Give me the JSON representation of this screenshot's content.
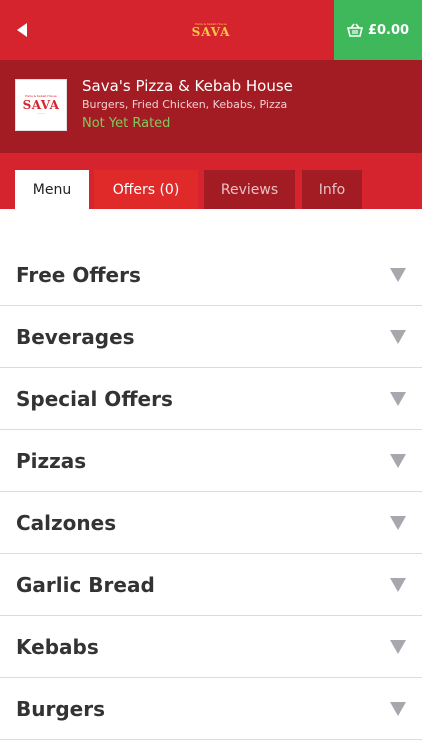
{
  "header": {
    "back_icon": "back-arrow-icon",
    "logo_text": "SAVA",
    "logo_tagline": "Pizza & Kebab House",
    "cart_icon": "basket-icon",
    "cart_total": "£0.00"
  },
  "restaurant": {
    "logo_text": "SAVA",
    "logo_tagline": "Pizza & Kebab House",
    "name": "Sava's Pizza & Kebab House",
    "cuisine": "Burgers, Fried Chicken, Kebabs, Pizza",
    "rating": "Not Yet Rated"
  },
  "tabs": [
    {
      "label": "Menu",
      "active": true
    },
    {
      "label": "Offers (0)",
      "active": false
    },
    {
      "label": "Reviews",
      "active": false
    },
    {
      "label": "Info",
      "active": false
    }
  ],
  "categories": [
    {
      "label": "Free Offers"
    },
    {
      "label": "Beverages"
    },
    {
      "label": "Special Offers"
    },
    {
      "label": "Pizzas"
    },
    {
      "label": "Calzones"
    },
    {
      "label": "Garlic Bread"
    },
    {
      "label": "Kebabs"
    },
    {
      "label": "Burgers"
    }
  ],
  "colors": {
    "brand_red": "#d6242e",
    "dark_red": "#a41c23",
    "cart_green": "#3fb85c",
    "rating_green": "#7fc95e",
    "arrow_grey": "#a7a7ad"
  }
}
